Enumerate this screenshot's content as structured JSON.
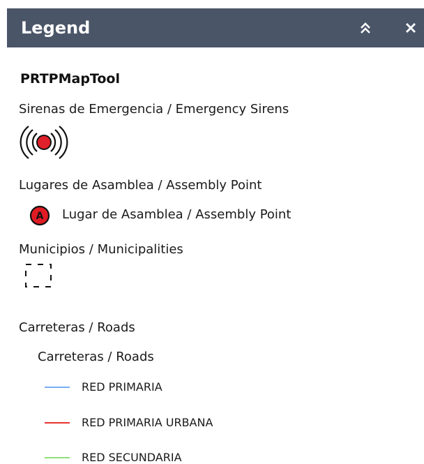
{
  "header": {
    "title": "Legend",
    "collapse_icon": "chevrons-up-icon",
    "close_icon": "close-icon"
  },
  "layer": {
    "title": "PRTPMapTool"
  },
  "groups": {
    "sirens": {
      "label": "Sirenas de Emergencia / Emergency Sirens",
      "icon": "siren-icon"
    },
    "assembly": {
      "label": "Lugares de Asamblea / Assembly Point",
      "item_label": "Lugar de Asamblea / Assembly Point",
      "icon_letter": "A",
      "icon": "assembly-point-icon"
    },
    "municipalities": {
      "label": "Municipios / Municipalities",
      "icon": "dashed-boundary-icon"
    },
    "roads": {
      "label": "Carreteras / Roads",
      "sublabel": "Carreteras / Roads",
      "items": [
        {
          "label": "RED PRIMARIA",
          "color": "#7aaef2"
        },
        {
          "label": "RED PRIMARIA URBANA",
          "color": "#e8322e"
        },
        {
          "label": "RED SECUNDARIA",
          "color": "#8fe07a"
        }
      ]
    }
  },
  "colors": {
    "header_bg": "#4a5568",
    "siren_red": "#e0202a",
    "assembly_red": "#e01b24"
  }
}
